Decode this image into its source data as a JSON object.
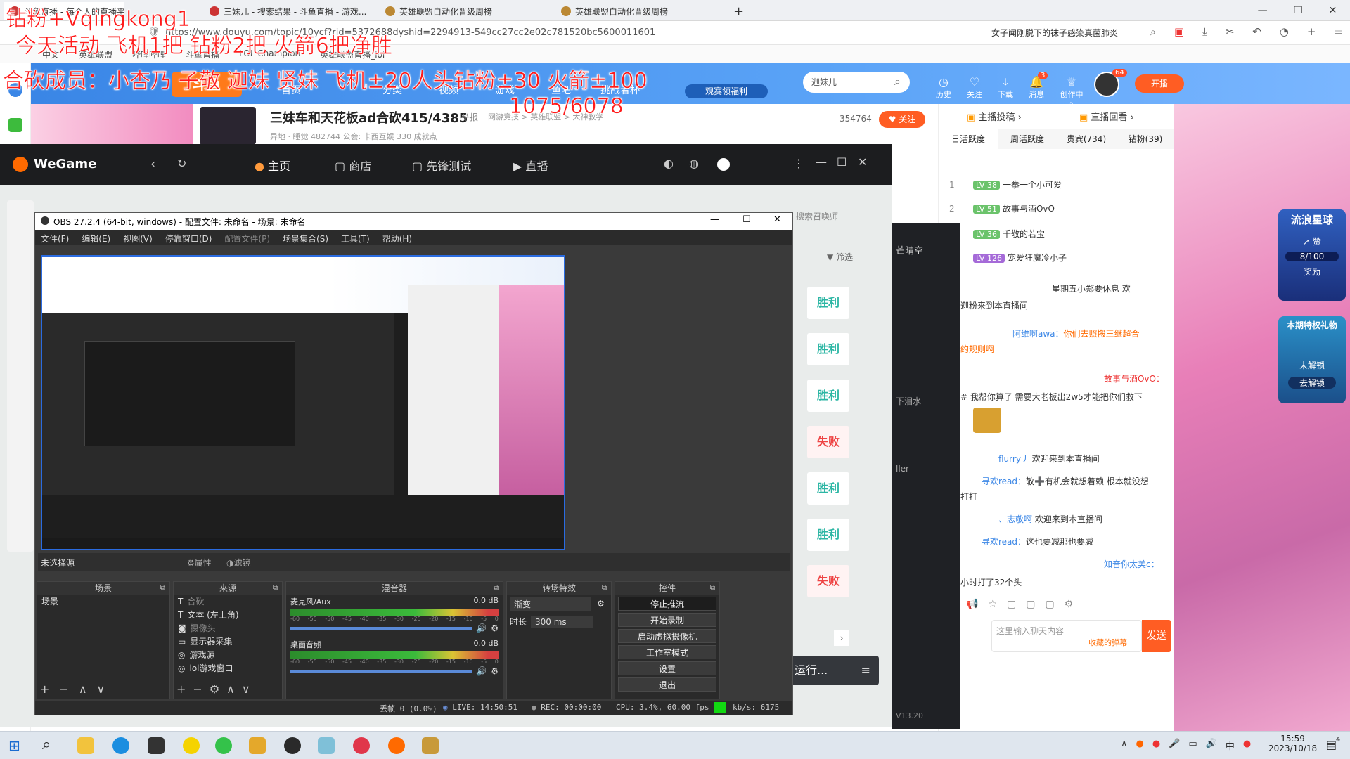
{
  "browser": {
    "tabs": [
      {
        "label": "斗鱼直播 - 每个人的直播平台"
      },
      {
        "label": "三妹儿 - 搜索结果 - 斗鱼直播 - 游戏..."
      },
      {
        "label": "英雄联盟自动化晋级周榜"
      },
      {
        "label": "英雄联盟自动化晋级周榜"
      }
    ],
    "new_tab": "+",
    "url": "https://www.douyu.com/topic/10ycf?rid=5372688dyshid=2294913-549cc27cc2e02c781520bc5600011601",
    "search_hint": "女子闻刚脱下的袜子感染真菌肺炎",
    "bookmarks": [
      "中文",
      "英雄联盟",
      "哔哩哔哩",
      "斗鱼直播",
      "LOL Champion",
      "英雄联盟直播_lol"
    ]
  },
  "overlay": {
    "line1": "钻粉+Vqingkong1",
    "line2": "今天活动 飞机1把 钻粉2把 火箭6把净胜",
    "line3": "合砍成员：小杏乃 子敬 迦妹 贤妹 飞机±20人头钻粉±30 火箭±100",
    "line4": "1075/6078"
  },
  "douyu": {
    "logo": "斗鱼",
    "nav": [
      "首页",
      "分类",
      "视频",
      "游戏",
      "鱼吧",
      "挑战者杯"
    ],
    "search_placeholder": "迦妹儿",
    "icons": [
      {
        "name": "history-icon",
        "label": "历史"
      },
      {
        "name": "follow-icon",
        "label": "关注"
      },
      {
        "name": "download-icon",
        "label": "下载"
      },
      {
        "name": "message-icon",
        "label": "消息",
        "badge": "3"
      },
      {
        "name": "creator-icon",
        "label": "创作中心"
      }
    ],
    "avatar_badge": "64",
    "live_button": "开播",
    "promo": "观赛领福利"
  },
  "stream": {
    "title": "三妹车和天花板ad合砍415/4385",
    "report": "举报",
    "category": "网游竞技 > 英雄联盟 > 大神教学",
    "heat": "354764",
    "follow_button": "关注",
    "sub_info": "异地 · 睡觉  482744  公会: 卡西互娱  330 成就点",
    "buttons": [
      "主播投稿",
      "直播回看"
    ],
    "rank_tabs": [
      "日活跃度",
      "周活跃度",
      "贵宾(734)",
      "钻粉(39)"
    ],
    "ranks": [
      {
        "no": "1",
        "lvl": "LV 38",
        "name": "一拳一个小可爱"
      },
      {
        "no": "2",
        "lvl": "LV 51",
        "name": "故事与酒OvO"
      },
      {
        "no": "",
        "lvl": "LV 36",
        "name": "千敬的若宝"
      },
      {
        "no": "",
        "lvl": "LV 126",
        "name": "宠爱狂魔冷小子"
      }
    ],
    "chat": [
      {
        "user": "",
        "text": "星期五小郑要休息 欢"
      },
      {
        "user": "",
        "text": "迦粉来到本直播间"
      },
      {
        "user": "阿维啊awa：",
        "text": "你们去照搬王继超合"
      },
      {
        "user": "",
        "text": "约规则啊"
      },
      {
        "user": "故事与酒OvO：",
        "text": ""
      },
      {
        "user": "",
        "text": "# 我帮你算了 需要大老板出2w5才能把你们救下"
      },
      {
        "user": "flurry丿",
        "text": "欢迎来到本直播间"
      },
      {
        "user": "寻欢read：",
        "text": "敬➕有机会就想着赖 根本就没想"
      },
      {
        "user": "",
        "text": "打打"
      },
      {
        "user": "、志敬啊",
        "text": "欢迎来到本直播间"
      },
      {
        "user": "寻欢read：",
        "text": "这也要减那也要减"
      },
      {
        "user": "知音你太美c：",
        "text": ""
      },
      {
        "user": "",
        "text": "小时打了32个头"
      }
    ],
    "chat_placeholder": "这里输入聊天内容",
    "chat_hint": "收藏的弹幕",
    "send": "发送",
    "promo_title": "流浪星球",
    "promo_praise": "赞",
    "promo_count": "8/100",
    "promo_reward": "奖励",
    "promo2_title": "本期特权礼物",
    "promo2_btn": "去解锁",
    "promo2_status": "未解锁"
  },
  "wegame": {
    "logo": "WeGame",
    "nav": [
      "主页",
      "商店",
      "先锋测试",
      "直播"
    ],
    "search_placeholder": "搜索召唤师",
    "filter": "筛选",
    "results": [
      "胜利",
      "胜利",
      "胜利",
      "失败",
      "胜利",
      "胜利",
      "失败"
    ],
    "bottom_btn": "运行..."
  },
  "obs": {
    "title": "OBS 27.2.4 (64-bit, windows) - 配置文件: 未命名 - 场景: 未命名",
    "menu": [
      "文件(F)",
      "编辑(E)",
      "视图(V)",
      "停靠窗口(D)",
      "配置文件(P)",
      "场景集合(S)",
      "工具(T)",
      "帮助(H)"
    ],
    "no_source": "未选择源",
    "props_btn": "属性",
    "filter_btn": "滤镜",
    "docks": {
      "scenes": "场景",
      "sources": "来源",
      "mixer": "混音器",
      "transitions": "转场特效",
      "controls": "控件"
    },
    "scene_items": [
      "场景"
    ],
    "sources": [
      "合砍",
      "文本 (左上角)",
      "摄像头",
      "显示器采集",
      "游戏源",
      "lol游戏窗口"
    ],
    "mixer": [
      {
        "name": "麦克风/Aux",
        "db": "0.0 dB"
      },
      {
        "name": "桌面音频",
        "db": "0.0 dB"
      }
    ],
    "scale": [
      "-60",
      "-55",
      "-50",
      "-45",
      "-40",
      "-35",
      "-30",
      "-25",
      "-20",
      "-15",
      "-10",
      "-5",
      "0"
    ],
    "transition": "渐变",
    "duration_label": "时长",
    "duration": "300 ms",
    "controls": [
      "停止推流",
      "开始录制",
      "启动虚拟摄像机",
      "工作室模式",
      "设置",
      "退出"
    ],
    "status": {
      "dropped": "丢帧 0 (0.0%)",
      "live": "LIVE: 14:50:51",
      "rec": "REC: 00:00:00",
      "cpu": "CPU: 3.4%, 60.00 fps",
      "kbs": "kb/s: 6175"
    }
  },
  "side_panel": {
    "label": "芒晴空",
    "text1": "下泪水",
    "text2": "ller",
    "version": "V13.20"
  },
  "taskbar": {
    "time": "15:59",
    "date": "2023/10/18",
    "ime": "中",
    "notif": "4"
  },
  "colors": {
    "douyu_blue": "#3a86e6",
    "douyu_orange": "#ff5d23",
    "obs_bg": "#3a3a3a",
    "win": "#2cb6a4",
    "lose": "#e44444",
    "overlay_red": "#ff1a1a"
  }
}
